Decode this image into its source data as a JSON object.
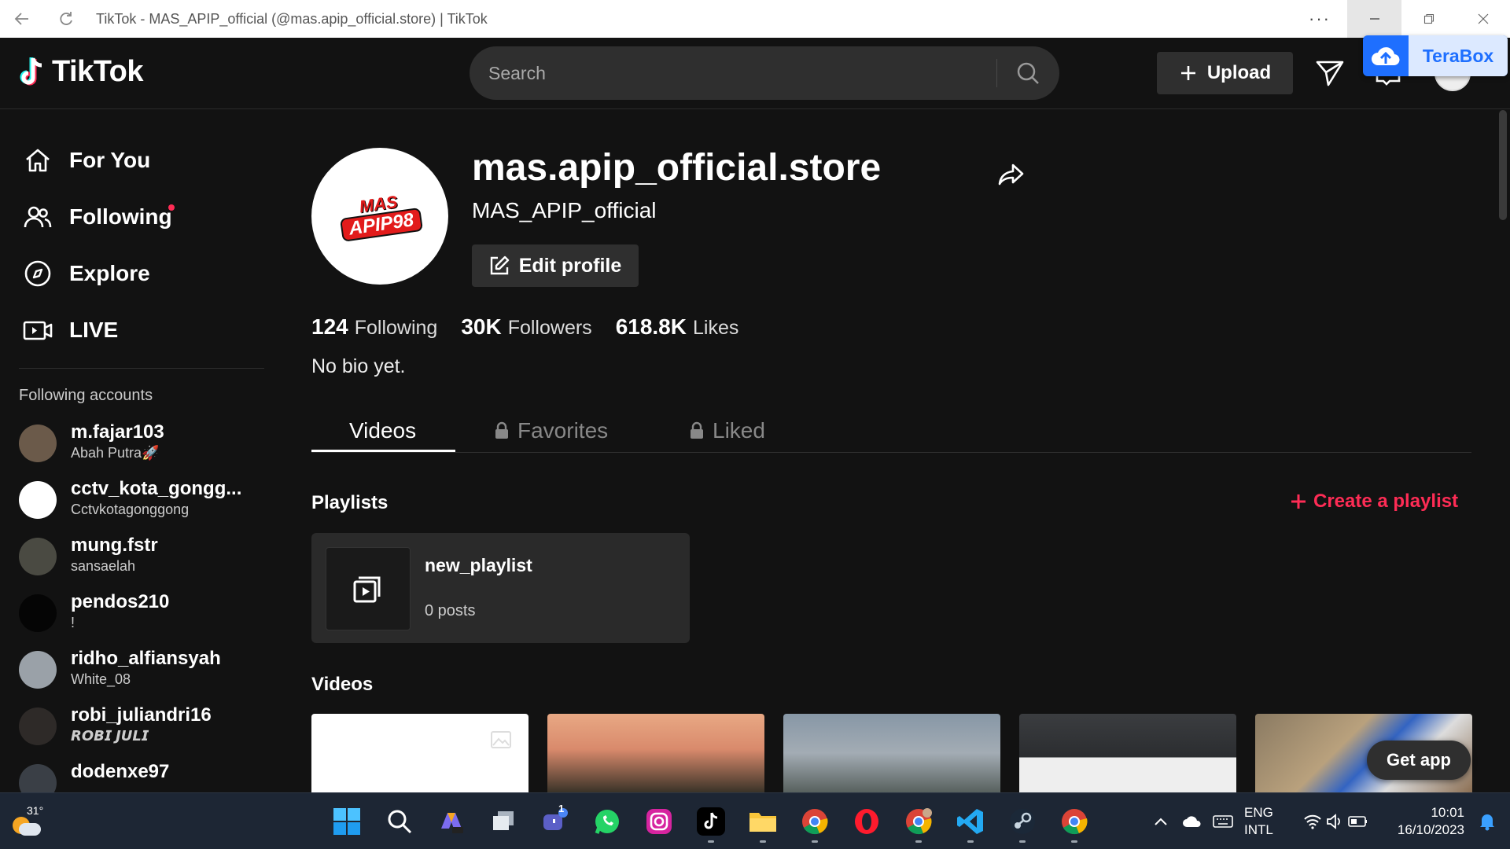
{
  "window": {
    "title": "TikTok - MAS_APIP_official (@mas.apip_official.store) | TikTok",
    "more": "···"
  },
  "header": {
    "logo_text": "TikTok",
    "search_placeholder": "Search",
    "upload_label": "Upload"
  },
  "terabox": {
    "label": "TeraBox"
  },
  "sidebar": {
    "nav": [
      {
        "label": "For You",
        "icon": "home-icon"
      },
      {
        "label": "Following",
        "icon": "following-icon"
      },
      {
        "label": "Explore",
        "icon": "compass-icon"
      },
      {
        "label": "LIVE",
        "icon": "live-icon"
      }
    ],
    "following_heading": "Following accounts",
    "accounts": [
      {
        "username": "m.fajar103",
        "nickname": "Abah Putra🚀",
        "avatar_color": "#6b5a4a"
      },
      {
        "username": "cctv_kota_gongg...",
        "nickname": "Cctvkotagonggong",
        "avatar_color": "#ffffff"
      },
      {
        "username": "mung.fstr",
        "nickname": "sansaelah",
        "avatar_color": "#4a4a42"
      },
      {
        "username": "pendos210",
        "nickname": "!",
        "avatar_color": "#050505"
      },
      {
        "username": "ridho_alfiansyah",
        "nickname": "White_08",
        "avatar_color": "#9aa1a8"
      },
      {
        "username": "robi_juliandri16",
        "nickname": "𝙍𝙊𝘽𝙄 𝙅𝙐𝙇𝙄",
        "avatar_color": "#2e2a28"
      },
      {
        "username": "dodenxe97",
        "nickname": "",
        "avatar_color": "#3a3f46"
      }
    ]
  },
  "profile": {
    "avatar_brand_top": "MAS",
    "avatar_brand_bottom": "APIP98",
    "username": "mas.apip_official.store",
    "nickname": "MAS_APIP_official",
    "edit_label": "Edit profile",
    "stats": [
      {
        "value": "124",
        "label": "Following"
      },
      {
        "value": "30K",
        "label": "Followers"
      },
      {
        "value": "618.8K",
        "label": "Likes"
      }
    ],
    "bio": "No bio yet."
  },
  "tabs": [
    {
      "label": "Videos",
      "locked": false,
      "active": true
    },
    {
      "label": "Favorites",
      "locked": true,
      "active": false
    },
    {
      "label": "Liked",
      "locked": true,
      "active": false
    }
  ],
  "playlists": {
    "heading": "Playlists",
    "create_label": "Create a playlist",
    "items": [
      {
        "name": "new_playlist",
        "count": "0 posts"
      }
    ]
  },
  "videos": {
    "heading": "Videos"
  },
  "get_app_label": "Get app",
  "taskbar": {
    "weather_temp": "31°",
    "lang_line1": "ENG",
    "lang_line2": "INTL",
    "time": "10:01",
    "date": "16/10/2023",
    "apps": [
      "windows-start-icon",
      "search-icon",
      "copilot-icon",
      "task-view-icon",
      "teams-icon",
      "whatsapp-icon",
      "instagram-icon",
      "tiktok-icon",
      "file-explorer-icon",
      "chrome-icon",
      "opera-icon",
      "chrome-profile-icon",
      "vscode-icon",
      "steam-icon",
      "chrome-icon"
    ],
    "badge": "1"
  },
  "colors": {
    "accent": "#fe2c55",
    "background": "#121212",
    "card": "#2f2f2f",
    "terabox": "#1e6fff"
  }
}
